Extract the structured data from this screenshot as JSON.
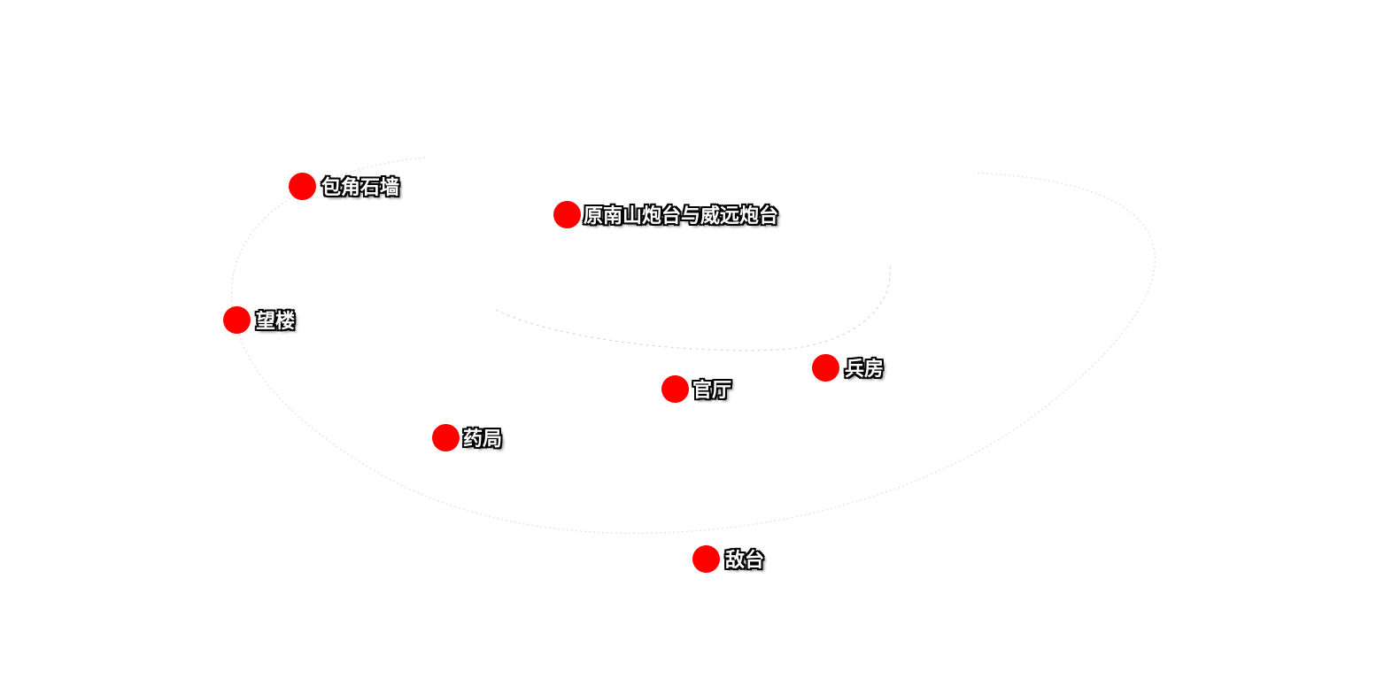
{
  "map": {
    "marker_color": "#ff0000",
    "label_color": "#ffffff",
    "label_outline_color": "#000000",
    "points": [
      {
        "id": "baojiao-shiqiang",
        "label": "包角石墙"
      },
      {
        "id": "yuan-nanshan-paotai",
        "label": "原南山炮台与威远炮台"
      },
      {
        "id": "wanglou",
        "label": "望楼"
      },
      {
        "id": "bingfang",
        "label": "兵房"
      },
      {
        "id": "guanting",
        "label": "官厅"
      },
      {
        "id": "yaoju",
        "label": "药局"
      },
      {
        "id": "ditai",
        "label": "敌台"
      }
    ]
  }
}
